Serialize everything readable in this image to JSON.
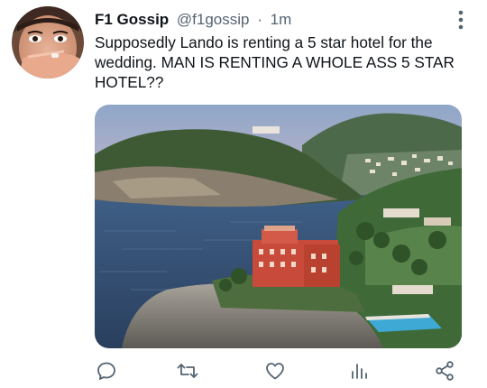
{
  "tweet": {
    "display_name": "F1 Gossip",
    "handle": "@f1gossip",
    "separator": "·",
    "timestamp": "1m",
    "text": "Supposedly Lando is renting a 5 star hotel for the wedding. MAN IS RENTING A WHOLE ASS 5 STAR HOTEL??"
  },
  "icons": {
    "more": "more-vertical-icon",
    "reply": "reply-icon",
    "retweet": "retweet-icon",
    "like": "heart-icon",
    "analytics": "analytics-icon",
    "share": "share-icon"
  },
  "colors": {
    "text": "#0f1419",
    "secondary": "#536471",
    "icon": "#536471"
  }
}
